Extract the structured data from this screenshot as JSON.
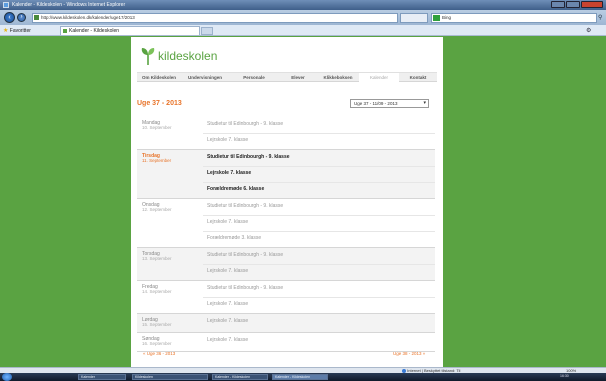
{
  "browser": {
    "window_title": "Kalender - Kildeskolen - Windows Internet Explorer",
    "address_url": "http://www.kildeskolen.dk/kalender/uge17/2013",
    "search_engine": "Bing",
    "favorites_label": "Favoritter",
    "tab_label": "Kalender - Kildeskolen",
    "status_zone": "Internet | Beskyttet tilstand: Til",
    "status_zoom": "100%"
  },
  "site": {
    "logo_text": "kildeskolen",
    "brand_color": "#5aa342",
    "accent_color": "#e8742a"
  },
  "menu": {
    "items": [
      {
        "label": "Om Kildeskolen"
      },
      {
        "label": "Undervisningen"
      },
      {
        "label": "Personale"
      },
      {
        "label": "Elever"
      },
      {
        "label": "Klikkeboksen"
      },
      {
        "label": "Kalender",
        "active": true
      },
      {
        "label": "Kontakt"
      }
    ]
  },
  "calendar": {
    "week_title": "Uge 37 - 2013",
    "week_select_value": "Uge 37 - 11/09 - 2013",
    "prev_link": "« Uge 36 - 2013",
    "next_link": "Uge 38 - 2013 »",
    "days": [
      {
        "name": "Mandag",
        "date": "10. September",
        "events": [
          "Studietur til Edinbourgh - 9. klasse",
          "Lejrskole 7. klasse"
        ]
      },
      {
        "name": "Tirsdag",
        "date": "11. September",
        "today": true,
        "events": [
          "Studietur til Edinbourgh - 9. klasse",
          "Lejrskole 7. klasse",
          "Forældremøde 6. klasse"
        ]
      },
      {
        "name": "Onsdag",
        "date": "12. September",
        "events": [
          "Studietur til Edinbourgh - 9. klasse",
          "Lejrskole 7. klasse",
          "Forældremøde 3. klasse"
        ]
      },
      {
        "name": "Torsdag",
        "date": "13. September",
        "events": [
          "Studietur til Edinbourgh - 9. klasse",
          "Lejrskole 7. klasse"
        ]
      },
      {
        "name": "Fredag",
        "date": "14. September",
        "events": [
          "Studietur til Edinbourgh - 9. klasse",
          "Lejrskole 7. klasse"
        ]
      },
      {
        "name": "Lørdag",
        "date": "15. September",
        "events": [
          "Lejrskole 7. klasse"
        ]
      },
      {
        "name": "Søndag",
        "date": "16. September",
        "events": [
          "Lejrskole 7. klasse"
        ]
      }
    ]
  },
  "taskbar": {
    "buttons": [
      "Kalender",
      "Kildeskolen",
      "Kalender - Kildeskolen",
      "Kalender - Kildeskolen"
    ],
    "clock": "16:30"
  }
}
